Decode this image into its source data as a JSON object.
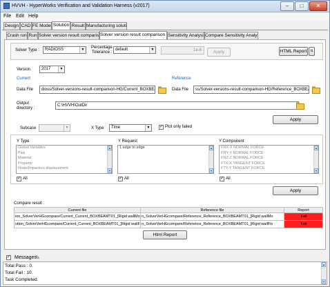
{
  "window": {
    "title": "HVVH - HyperWorks Verification and Validation Harness (v2017)"
  },
  "menu": [
    "File",
    "Edit",
    "Help"
  ],
  "main_tabs": [
    "Design",
    "CAD",
    "FE Model",
    "Solution",
    "Result",
    "Manufacturing solution"
  ],
  "sub_tabs": [
    "Crash run",
    "Run",
    "Solver version result comparison",
    "Solver version result comparison HG",
    "Sensitivity Analysis",
    "Compare Sensitivity Analysis"
  ],
  "top_bar": {
    "solver_type_label": "Solver Type :",
    "solver_type_value": "RADIOSS",
    "percentage_label_1": "Percentage",
    "percentage_label_2": "Tolerance :",
    "percentage_value": "default",
    "tolerance_value": "1e-6",
    "apply_label": "Apply",
    "html_report_label": "HTML Report"
  },
  "version": {
    "label": "Version",
    "value": "2017"
  },
  "current": {
    "heading": "Current",
    "data_file_label": "Data File",
    "data_file_value": "dioss/Solver-versions-result-comparison-HG/Current_BOXBEAMT01"
  },
  "reference": {
    "heading": "Reference",
    "data_file_label": "Data File",
    "data_file_value": "ss/Solver-versions-result-comparison-HG/Reference_BOXBEAMT01"
  },
  "output": {
    "label_1": "Output",
    "label_2": "directory :",
    "value": "C:\\HVVH\\OutDir"
  },
  "apply_1": "Apply",
  "subcase": {
    "label": "Subcase",
    "value": ""
  },
  "xtype": {
    "label": "X Type",
    "value": "Time"
  },
  "plot_only_failed": {
    "label": "Plot only failed",
    "checked": true
  },
  "ytype": {
    "label": "Y Type",
    "items": [
      "Global Variables",
      "Part",
      "Material",
      "Property",
      "Node/Impactors displacement"
    ],
    "all_label": "All"
  },
  "yrequest": {
    "label": "Y Request",
    "items": [
      "1 edge to edge"
    ],
    "all_label": "All"
  },
  "ycomponent": {
    "label": "Y Component",
    "items": [
      "FNX-X NORMAL FORCE",
      "FNY-Y NORMAL FORCE",
      "FNZ-Z NORMAL FORCE",
      "FTX-X TANGENT FORCE",
      "FTY-Y TANGENT FORCE"
    ],
    "all_label": "All"
  },
  "apply_2": "Apply",
  "compare": {
    "label": "Compare result :",
    "headers": [
      "Current file",
      "Reference file",
      "Report"
    ],
    "rows": [
      {
        "current": "ion_SolverVerHGcompare/Current_Current_BOXBEAMT01_[Rigid wallMovin",
        "reference": "n_SolverVerHGcompare/Reference_Reference_BOXBEAMT01_[Rigid wallMo",
        "report": "Fail"
      },
      {
        "current": "ution_SolverVerHGcompare/Current_Current_BOXBEAMT01_[Rigid wallFixed",
        "reference": "n_SolverVerHGcompare/Reference_Reference_BOXBEAMT01_[Rigid wallFix",
        "report": "Fail"
      }
    ],
    "html_report_label": "Html Report"
  },
  "messages": {
    "label": "Messages",
    "lines": [
      "Total Pass : 0.",
      "Total Fail : 10.",
      "Task Completed."
    ]
  },
  "colors": {
    "fail": "#ff1e1e",
    "link_blue": "#1a5fb4"
  }
}
